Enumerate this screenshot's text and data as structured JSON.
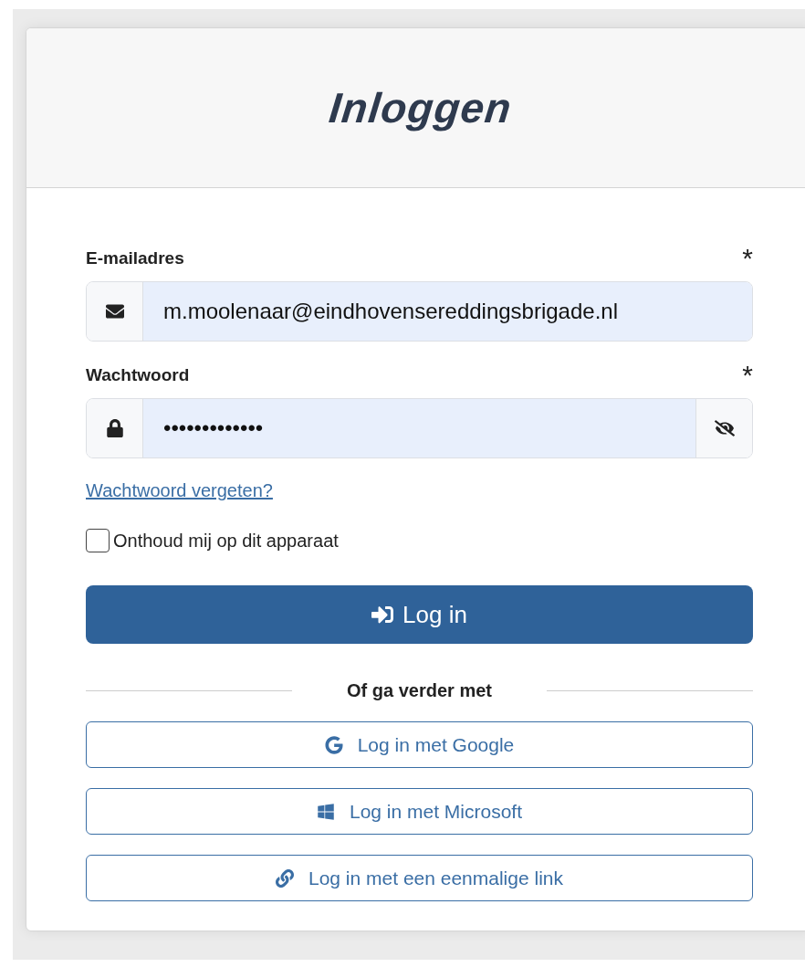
{
  "title": "Inloggen",
  "fields": [
    {
      "kind": "email",
      "label": "E-mailadres",
      "required_mark": "*",
      "value": "m.moolenaar@eindhovensereddingsbrigade.nl"
    },
    {
      "kind": "password",
      "label": "Wachtwoord",
      "required_mark": "*",
      "value": "•••••••••••••"
    }
  ],
  "forgot_link": "Wachtwoord vergeten?",
  "remember": {
    "label": "Onthoud mij op dit apparaat",
    "checked": false
  },
  "login_button": "Log in",
  "divider": "Of ga verder met",
  "alt_logins": [
    {
      "kind": "google",
      "label": "Log in met Google"
    },
    {
      "kind": "microsoft",
      "label": "Log in met Microsoft"
    },
    {
      "kind": "link",
      "label": "Log in met een eenmalige link"
    }
  ]
}
